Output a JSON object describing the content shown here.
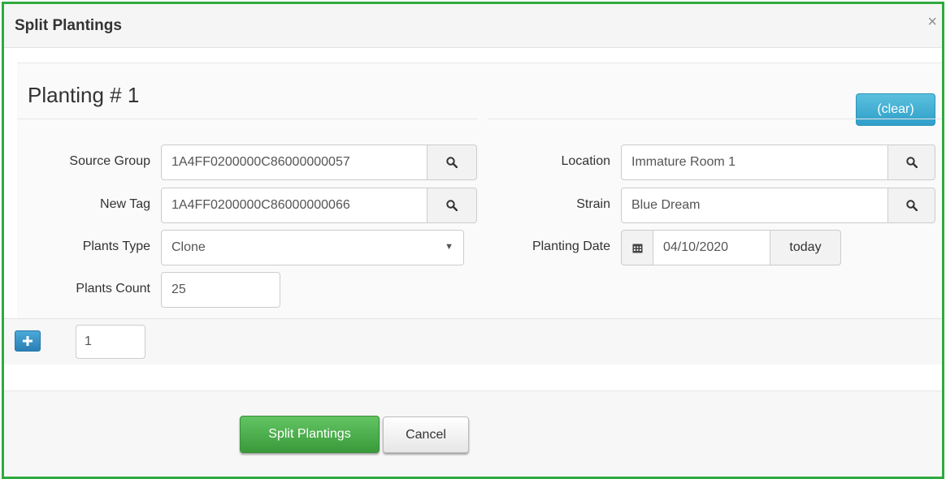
{
  "dialog": {
    "title": "Split Plantings",
    "close_glyph": "×"
  },
  "planting": {
    "heading": "Planting # 1",
    "clear_label": "(clear)"
  },
  "form": {
    "source_group": {
      "label": "Source Group",
      "value": "1A4FF0200000C86000000057"
    },
    "new_tag": {
      "label": "New Tag",
      "value": "1A4FF0200000C86000000066"
    },
    "plants_type": {
      "label": "Plants Type",
      "value": "Clone"
    },
    "plants_count": {
      "label": "Plants Count",
      "value": "25"
    },
    "location": {
      "label": "Location",
      "value": "Immature Room 1"
    },
    "strain": {
      "label": "Strain",
      "value": "Blue Dream"
    },
    "planting_date": {
      "label": "Planting Date",
      "value": "04/10/2020",
      "today_label": "today"
    }
  },
  "add_row": {
    "count_value": "1"
  },
  "footer": {
    "submit_label": "Split Plantings",
    "cancel_label": "Cancel"
  },
  "icons": {
    "search": "search-icon",
    "calendar": "calendar-icon",
    "plus": "plus-icon",
    "caret": "caret-down-icon",
    "close": "close-icon"
  },
  "colors": {
    "frame_border": "#2eaa3f",
    "clear_button": "#3aa8d4",
    "submit_button": "#4cae4c",
    "plus_button": "#2f8fc4"
  }
}
